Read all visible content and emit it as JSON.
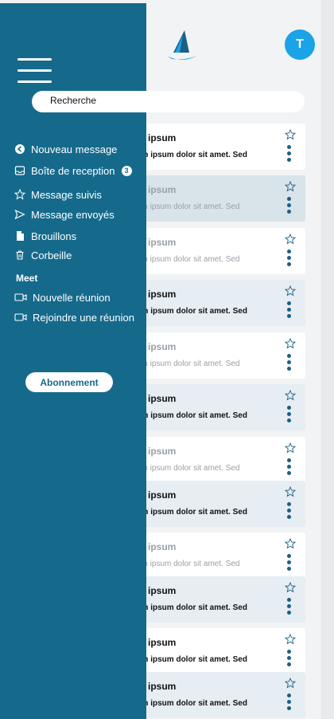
{
  "user": {
    "avatar_initial": "T"
  },
  "search": {
    "placeholder": "Recherche"
  },
  "menu": {
    "items": [
      {
        "label": "Nouveau message",
        "icon": "plus-circle-icon"
      },
      {
        "label": "Boîte de reception",
        "icon": "inbox-icon",
        "badge": "3"
      },
      {
        "label": "Message suivis",
        "icon": "star-outline-icon"
      },
      {
        "label": "Message envoyés",
        "icon": "send-icon"
      },
      {
        "label": "Brouillons",
        "icon": "draft-icon"
      },
      {
        "label": "Corbeille",
        "icon": "trash-icon"
      }
    ],
    "section_meet": "Meet",
    "meet_items": [
      {
        "label": "Nouvelle réunion",
        "icon": "video-camera-icon"
      },
      {
        "label": "Rejoindre une réunion",
        "icon": "video-camera-icon"
      }
    ],
    "subscribe_label": "Abonnement"
  },
  "mails": [
    {
      "sender": "m ipsum",
      "preview": "em ipsum dolor sit amet. Sed",
      "state": "unread"
    },
    {
      "sender": "m ipsum",
      "preview": "em ipsum dolor sit amet. Sed",
      "state": "read"
    },
    {
      "sender": "m ipsum",
      "preview": "em ipsum dolor sit amet. Sed",
      "state": "read"
    },
    {
      "sender": "m ipsum",
      "preview": "em ipsum dolor sit amet. Sed",
      "state": "unread"
    },
    {
      "sender": "m ipsum",
      "preview": "em ipsum dolor sit amet. Sed",
      "state": "read"
    },
    {
      "sender": "m ipsum",
      "preview": "em ipsum dolor sit amet. Sed",
      "state": "unread"
    },
    {
      "sender": "m ipsum",
      "preview": "em ipsum dolor sit amet. Sed",
      "state": "read"
    },
    {
      "sender": "m ipsum",
      "preview": "em ipsum dolor sit amet. Sed",
      "state": "unread"
    },
    {
      "sender": "m ipsum",
      "preview": "em ipsum dolor sit amet. Sed",
      "state": "read"
    },
    {
      "sender": "m ipsum",
      "preview": "em ipsum dolor sit amet. Sed",
      "state": "unread"
    },
    {
      "sender": "m ipsum",
      "preview": "em ipsum dolor sit amet. Sed",
      "state": "unread"
    },
    {
      "sender": "m ipsum",
      "preview": "em ipsum dolor sit amet. Sed",
      "state": "unread"
    }
  ],
  "colors": {
    "drawer": "#156a8c",
    "accent": "#1aa3e6",
    "kebab": "#1b5f85"
  }
}
